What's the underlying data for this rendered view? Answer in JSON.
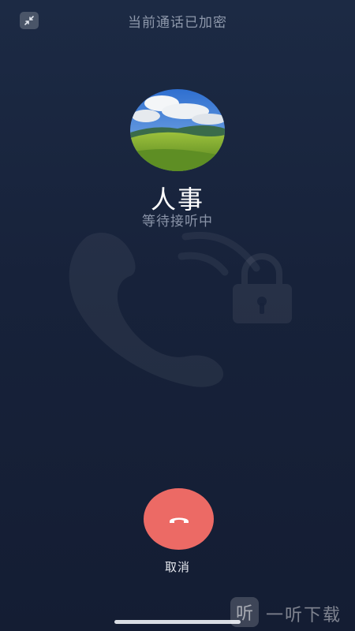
{
  "header": {
    "minimize_icon": "minimize-arrows-icon",
    "encryption_notice": "当前通话已加密"
  },
  "contact": {
    "name": "人事",
    "status": "等待接听中"
  },
  "actions": {
    "hangup_icon": "phone-hangup-icon",
    "hangup_label": "取消",
    "hangup_color": "#ec6a65"
  },
  "watermark": {
    "logo_glyph": "听",
    "text": "一听下载"
  },
  "colors": {
    "background_top": "#1c2a44",
    "background_bottom": "#141d33",
    "muted_text": "#8e98ab"
  }
}
